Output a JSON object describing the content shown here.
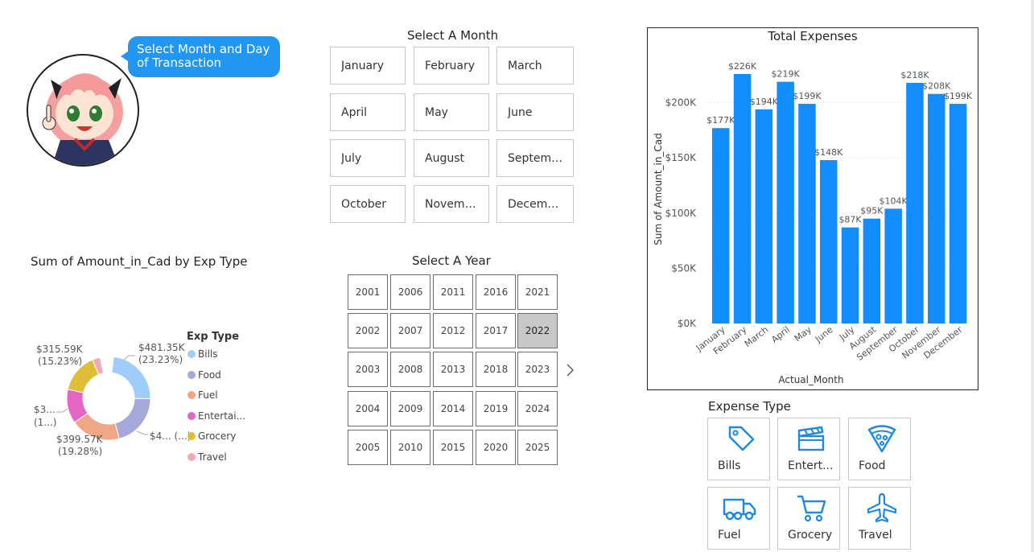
{
  "speech_bubble": {
    "text": "Select Month and Day of Transaction"
  },
  "month_slicer": {
    "title": "Select A Month",
    "months": [
      "January",
      "February",
      "March",
      "April",
      "May",
      "June",
      "July",
      "August",
      "Septemb...",
      "October",
      "November",
      "December"
    ]
  },
  "year_slicer": {
    "title": "Select A Year",
    "columns": [
      [
        "2001",
        "2002",
        "2003",
        "2004",
        "2005"
      ],
      [
        "2006",
        "2007",
        "2008",
        "2009",
        "2010"
      ],
      [
        "2011",
        "2012",
        "2013",
        "2014",
        "2015"
      ],
      [
        "2016",
        "2017",
        "2018",
        "2019",
        "2020"
      ],
      [
        "2021",
        "2022",
        "2023",
        "2024",
        "2025"
      ]
    ],
    "selected": "2022"
  },
  "donut": {
    "title": "Sum of Amount_in_Cad by Exp Type",
    "legend_title": "Exp Type",
    "legend": [
      {
        "label": "Bills",
        "color": "#9fcdfb"
      },
      {
        "label": "Food",
        "color": "#a5a8d8"
      },
      {
        "label": "Fuel",
        "color": "#f0a785"
      },
      {
        "label": "Entertai...",
        "color": "#e466c4"
      },
      {
        "label": "Grocery",
        "color": "#e0bd36"
      },
      {
        "label": "Travel",
        "color": "#f0aab4"
      }
    ],
    "labels": {
      "bills": "$481.35K\n(23.23%)",
      "food": "$4... (...)",
      "fuel": "$399.57K\n(19.28%)",
      "entertainment": "$3...\n(1...)",
      "grocery": "$315.59K\n(15.23%)"
    }
  },
  "total_expenses": {
    "title": "Total Expenses",
    "y_axis_title": "Sum of Amount_in_Cad",
    "x_axis_title": "Actual_Month",
    "y_ticks": [
      "$0K",
      "$50K",
      "$100K",
      "$150K",
      "$200K"
    ],
    "bar_color": "#118dff"
  },
  "chart_data": {
    "type": "bar",
    "title": "Total Expenses",
    "xlabel": "Actual_Month",
    "ylabel": "Sum of Amount_in_Cad",
    "categories": [
      "January",
      "February",
      "March",
      "April",
      "May",
      "June",
      "July",
      "August",
      "September",
      "October",
      "November",
      "December"
    ],
    "values": [
      177,
      226,
      194,
      219,
      199,
      148,
      87,
      95,
      104,
      218,
      208,
      199
    ],
    "value_labels": [
      "$177K",
      "$226K",
      "$194K",
      "$219K",
      "$199K",
      "$148K",
      "$87K",
      "$95K",
      "$104K",
      "$218K",
      "$208K",
      "$199K"
    ],
    "unit": "thousand CAD",
    "ylim": [
      0,
      226
    ],
    "grid": true
  },
  "expense_type": {
    "title": "Expense Type",
    "buttons": [
      {
        "label": "Bills",
        "icon": "tag-icon"
      },
      {
        "label": "Entert...",
        "icon": "clapperboard-icon"
      },
      {
        "label": "Food",
        "icon": "pizza-icon"
      },
      {
        "label": "Fuel",
        "icon": "truck-icon"
      },
      {
        "label": "Grocery",
        "icon": "cart-icon"
      },
      {
        "label": "Travel",
        "icon": "airplane-icon"
      }
    ],
    "icon_color": "#1e88e5"
  }
}
